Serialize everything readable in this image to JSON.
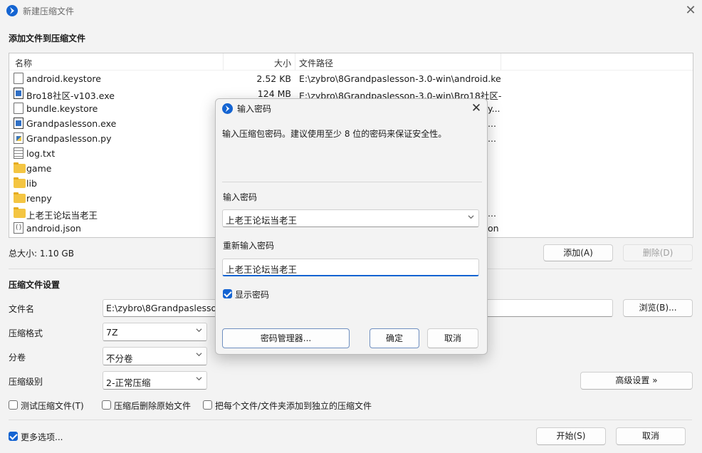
{
  "window": {
    "title": "新建压缩文件",
    "close_glyph": "✕"
  },
  "files_section": {
    "title": "添加文件到压缩文件",
    "columns": [
      "名称",
      "大小",
      "文件路径"
    ],
    "rows": [
      {
        "icon": "document-icon",
        "name": "android.keystore",
        "size": "2.52 KB",
        "path": "E:\\zybro\\8Grandpaslesson-3.0-win\\android.ke...",
        "tail": ""
      },
      {
        "icon": "executable-icon",
        "name": "Bro18社区-v103.exe",
        "size": "124 MB",
        "path": "E:\\zybro\\8Grandpaslesson-3.0-win\\Bro18社区-...",
        "tail": ""
      },
      {
        "icon": "document-icon",
        "name": "bundle.keystore",
        "size": "",
        "path": "",
        "tail": "y..."
      },
      {
        "icon": "executable-icon",
        "name": "Grandpaslesson.exe",
        "size": "",
        "path": "",
        "tail": "..."
      },
      {
        "icon": "python-file-icon",
        "name": "Grandpaslesson.py",
        "size": "",
        "path": "",
        "tail": "..."
      },
      {
        "icon": "text-file-icon",
        "name": "log.txt",
        "size": "",
        "path": "",
        "tail": ""
      },
      {
        "icon": "folder-icon",
        "name": "game",
        "size": "",
        "path": "",
        "tail": ""
      },
      {
        "icon": "folder-icon",
        "name": "lib",
        "size": "",
        "path": "",
        "tail": ""
      },
      {
        "icon": "folder-icon",
        "name": "renpy",
        "size": "",
        "path": "",
        "tail": ""
      },
      {
        "icon": "folder-icon",
        "name": "上老王论坛当老王",
        "size": "",
        "path": "",
        "tail": "..."
      },
      {
        "icon": "json-file-icon",
        "name": "android.json",
        "size": "",
        "path": "",
        "tail": "on"
      }
    ],
    "total_label": "总大小: 1.10 GB",
    "add_button": "添加(A)",
    "delete_button": "删除(D)"
  },
  "settings_section": {
    "title": "压缩文件设置",
    "filename_label": "文件名",
    "filename_value": "E:\\zybro\\8Grandpaslesson",
    "browse_button": "浏览(B)...",
    "format_label": "压缩格式",
    "format_value": "7Z",
    "split_label": "分卷",
    "split_value": "不分卷",
    "level_label": "压缩级别",
    "level_value": "2-正常压缩",
    "advanced_button": "高级设置 »",
    "test_checkbox": "测试压缩文件(T)",
    "delete_after_checkbox": "压缩后删除原始文件",
    "separate_checkbox": "把每个文件/文件夹添加到独立的压缩文件",
    "more_options": "更多选项...",
    "start_button": "开始(S)",
    "cancel_button": "取消"
  },
  "password_dialog": {
    "title": "输入密码",
    "close_glyph": "✕",
    "description": "输入压缩包密码。建议使用至少 8 位的密码来保证安全性。",
    "password_label": "输入密码",
    "password_value": "上老王论坛当老王",
    "reenter_label": "重新输入密码",
    "reenter_value": "上老王论坛当老王",
    "show_password": "显示密码",
    "show_password_checked": true,
    "manager_button": "密码管理器...",
    "ok_button": "确定",
    "cancel_button": "取消"
  },
  "colors": {
    "accent": "#1464d2",
    "window_bg": "#f3f3f3"
  }
}
